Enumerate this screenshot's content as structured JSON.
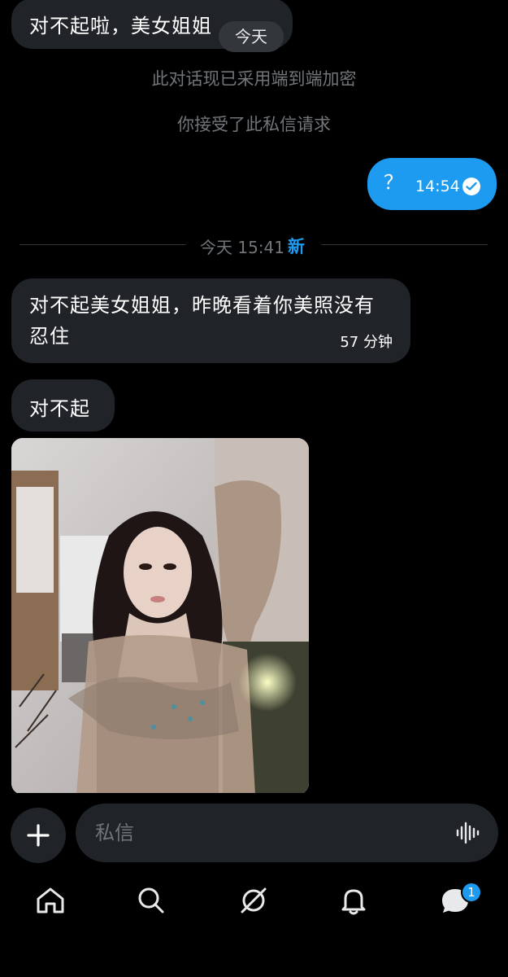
{
  "messages": {
    "top": {
      "text": "对不起啦，美女姐姐"
    },
    "today_chip": "今天",
    "system": [
      "此对话现已采用端到端加密",
      "你接受了此私信请求"
    ],
    "outgoing": {
      "text": "？",
      "time": "14:54"
    },
    "divider": {
      "label": "今天 15:41",
      "new_label": "新"
    },
    "incoming_1": {
      "text": "对不起美女姐姐，昨晚看着你美照没有忍住",
      "time": "57 分钟"
    },
    "incoming_2": {
      "text": "对不起"
    }
  },
  "composer": {
    "placeholder": "私信"
  },
  "nav": {
    "items": [
      "home-icon",
      "search-icon",
      "grok-icon",
      "bell-icon",
      "messages-icon"
    ],
    "messages_badge": "1"
  },
  "colors": {
    "accent": "#1d9bf0",
    "bubble_in": "#202327",
    "muted": "#71767b",
    "background": "#000000"
  }
}
